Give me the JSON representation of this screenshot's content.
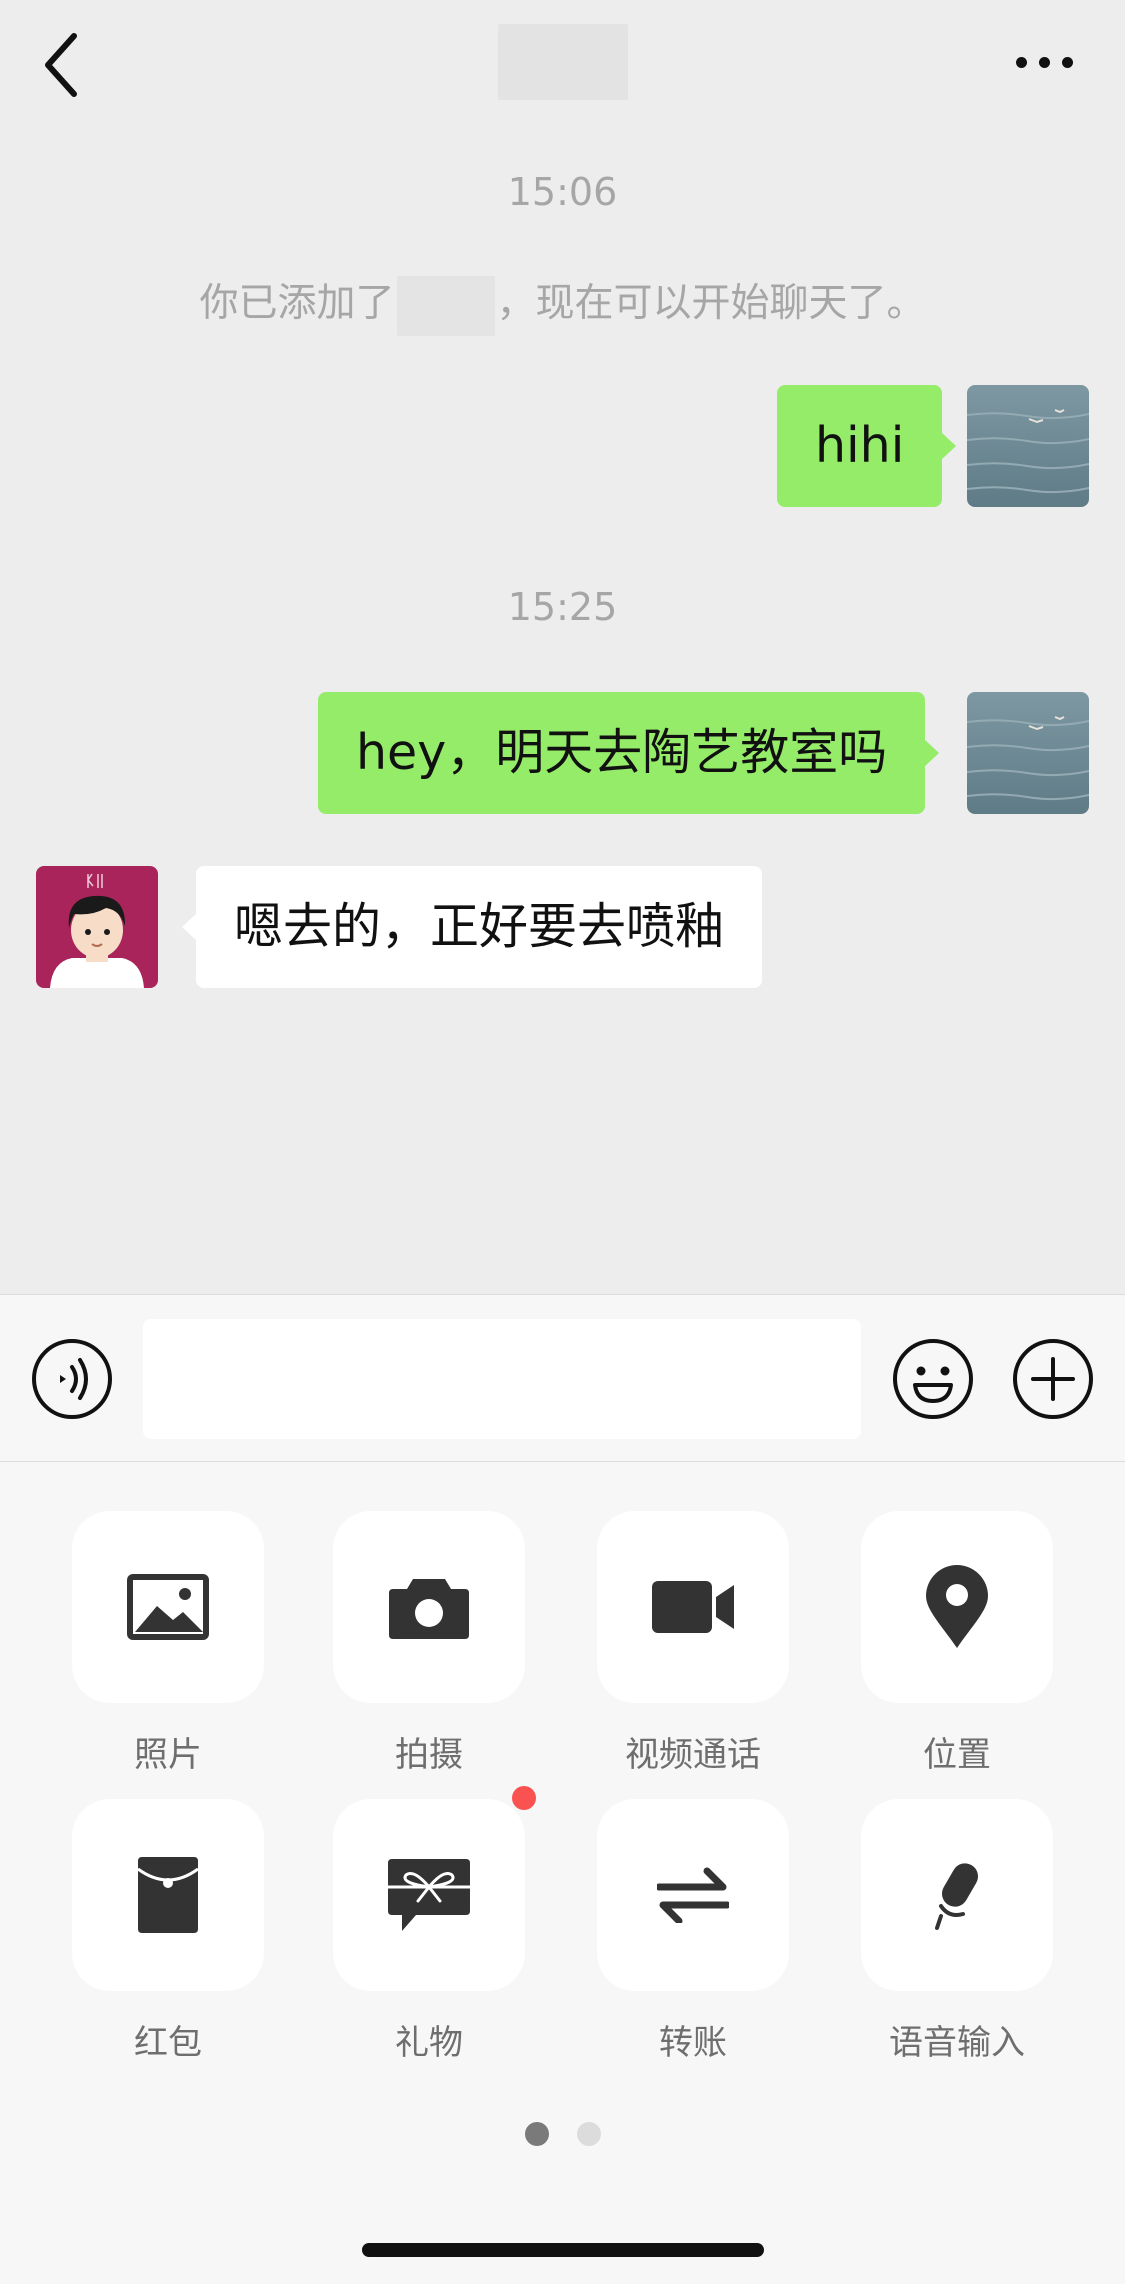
{
  "header": {
    "back_icon": "chevron-left-icon",
    "more_icon": "ellipsis-icon"
  },
  "chat": {
    "messages": [
      {
        "type": "time",
        "text": "15:06"
      },
      {
        "type": "system",
        "before": "你已添加了",
        "after": "，现在可以开始聊天了。"
      },
      {
        "type": "outgoing",
        "text": "hihi"
      },
      {
        "type": "time",
        "text": "15:25"
      },
      {
        "type": "outgoing",
        "text": "hey，明天去陶艺教室吗"
      },
      {
        "type": "incoming",
        "text": "嗯去的，正好要去喷釉"
      }
    ]
  },
  "input_bar": {
    "voice_icon": "voice-icon",
    "emoji_icon": "emoji-icon",
    "plus_icon": "plus-circle-icon",
    "input_value": ""
  },
  "panel": {
    "tiles": [
      {
        "label": "照片",
        "icon": "image-icon"
      },
      {
        "label": "拍摄",
        "icon": "camera-icon"
      },
      {
        "label": "视频通话",
        "icon": "video-call-icon"
      },
      {
        "label": "位置",
        "icon": "location-pin-icon"
      },
      {
        "label": "红包",
        "icon": "red-packet-icon"
      },
      {
        "label": "礼物",
        "icon": "gift-icon"
      },
      {
        "label": "转账",
        "icon": "transfer-icon"
      },
      {
        "label": "语音输入",
        "icon": "microphone-icon"
      }
    ],
    "page_count": 2,
    "current_page": 1
  },
  "colors": {
    "background": "#EDEDED",
    "outgoing_bubble": "#95EC69",
    "incoming_bubble": "#FFFFFF",
    "badge": "#FA5151",
    "panel": "#F7F7F7"
  }
}
